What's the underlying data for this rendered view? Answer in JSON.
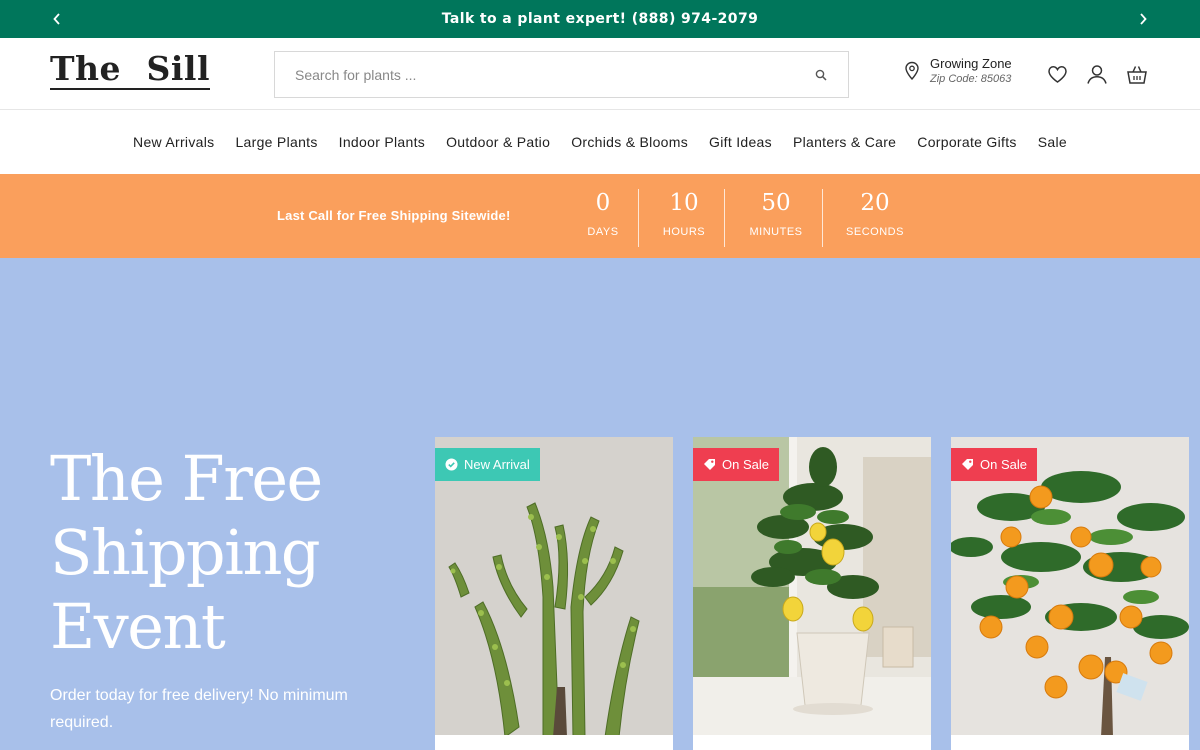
{
  "announcement": {
    "text": "Talk to a plant expert! (888) 974-2079"
  },
  "logo": {
    "word1": "The",
    "word2": "Sill"
  },
  "search": {
    "placeholder": "Search for plants ..."
  },
  "zone": {
    "title": "Growing Zone",
    "zip": "Zip Code: 85063"
  },
  "nav": {
    "items": [
      "New Arrivals",
      "Large Plants",
      "Indoor Plants",
      "Outdoor & Patio",
      "Orchids & Blooms",
      "Gift Ideas",
      "Planters & Care",
      "Corporate Gifts",
      "Sale"
    ]
  },
  "countdown": {
    "message": "Last Call for Free Shipping Sitewide!",
    "units": [
      {
        "value": "0",
        "label": "DAYS"
      },
      {
        "value": "10",
        "label": "HOURS"
      },
      {
        "value": "50",
        "label": "MINUTES"
      },
      {
        "value": "20",
        "label": "SECONDS"
      }
    ]
  },
  "hero": {
    "title": "The Free Shipping Event",
    "subtitle": "Order today for free delivery! No minimum required."
  },
  "cards": [
    {
      "badge": "New Arrival",
      "badge_color": "#3dc8b4",
      "icon": "badge-check-icon"
    },
    {
      "badge": "On Sale",
      "badge_color": "#ef3e50",
      "icon": "tag-icon"
    },
    {
      "badge": "On Sale",
      "badge_color": "#ef3e50",
      "icon": "tag-icon"
    }
  ],
  "colors": {
    "announce_bg": "#00765b",
    "countdown_bg": "#fa9f5c",
    "hero_bg": "#a8c0ea"
  }
}
